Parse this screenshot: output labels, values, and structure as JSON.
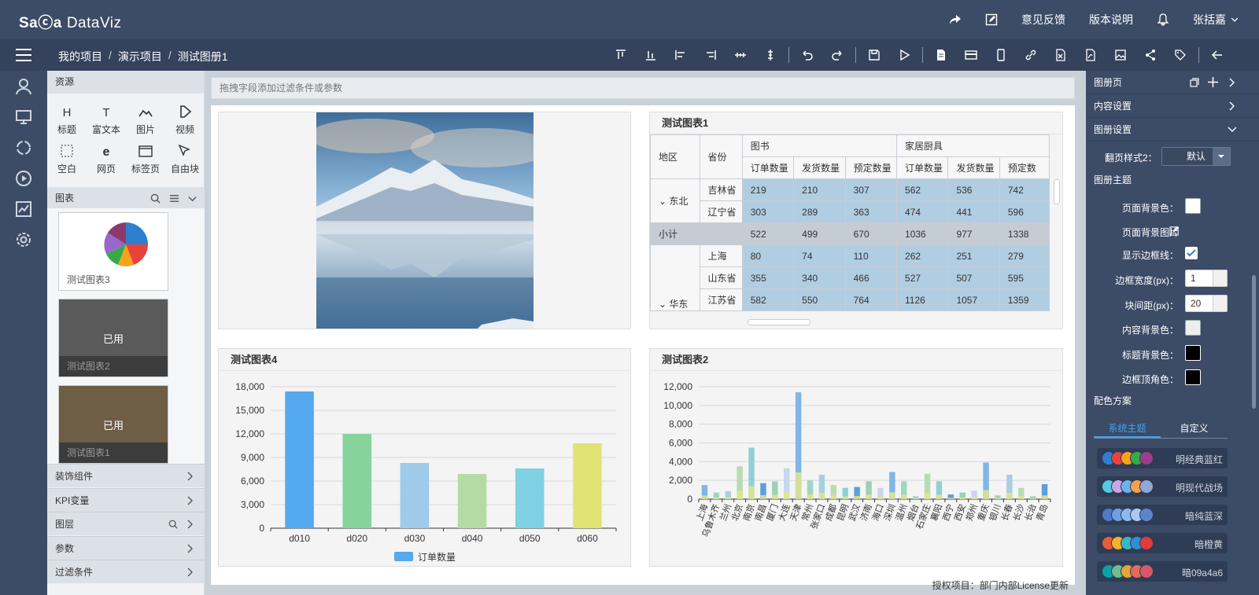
{
  "app": {
    "logo": "Sa",
    "logo_mid": "ⓒa",
    "logo_rest": "DataViz"
  },
  "topbar": {
    "feedback": "意见反馈",
    "version": "版本说明",
    "user": "张括嘉"
  },
  "breadcrumb": [
    "我的项目",
    "演示项目",
    "测试图册1"
  ],
  "toolbar_icons": [
    "align-top-icon",
    "align-bottom-icon",
    "align-left-icon",
    "align-right-icon",
    "distribute-h-icon",
    "distribute-v-icon",
    "undo-icon",
    "redo-icon",
    "save-icon",
    "play-icon",
    "page-icon",
    "card-icon",
    "mobile-icon",
    "link-icon",
    "excel-icon",
    "pdf-icon",
    "image-icon",
    "share-icon",
    "tag-icon",
    "back-icon"
  ],
  "left_panel": {
    "resources_title": "资源",
    "resources": [
      {
        "label": "标题",
        "icon": "heading-icon"
      },
      {
        "label": "富文本",
        "icon": "richtext-icon"
      },
      {
        "label": "图片",
        "icon": "picture-icon"
      },
      {
        "label": "视频",
        "icon": "video-icon"
      },
      {
        "label": "空白",
        "icon": "blank-icon"
      },
      {
        "label": "网页",
        "icon": "webpage-icon"
      },
      {
        "label": "标签页",
        "icon": "tabpage-icon"
      },
      {
        "label": "自由块",
        "icon": "freeblock-icon"
      }
    ],
    "charts_title": "图表",
    "chart_items": [
      {
        "label": "测试图表3",
        "used": ""
      },
      {
        "label": "测试图表2",
        "used": "已用"
      },
      {
        "label": "测试图表1",
        "used": "已用"
      }
    ],
    "sections": [
      "装饰组件",
      "KPI变量",
      "图层",
      "参数",
      "过滤条件"
    ]
  },
  "canvas": {
    "filter_placeholder": "拖拽字段添加过滤条件或参数",
    "license": "授权项目：部门内部License更新"
  },
  "pivot": {
    "title": "测试图表1",
    "region_header": "地区",
    "province_header": "省份",
    "groups": [
      "图书",
      "家居厨具"
    ],
    "measures": [
      "订单数量",
      "发货数量",
      "预定数量",
      "订单数量",
      "发货数量",
      "预定数"
    ],
    "rows": [
      {
        "region": "东北",
        "province": "吉林省",
        "values": [
          "219",
          "210",
          "307",
          "562",
          "536",
          "742"
        ]
      },
      {
        "region": "",
        "province": "辽宁省",
        "values": [
          "303",
          "289",
          "363",
          "474",
          "441",
          "596"
        ]
      },
      {
        "region": "小计",
        "province": "",
        "values": [
          "522",
          "499",
          "670",
          "1036",
          "977",
          "1338"
        ]
      },
      {
        "region": "华东",
        "province": "上海",
        "values": [
          "80",
          "74",
          "110",
          "262",
          "251",
          "279"
        ]
      },
      {
        "region": "",
        "province": "山东省",
        "values": [
          "355",
          "340",
          "466",
          "527",
          "507",
          "595"
        ]
      },
      {
        "region": "",
        "province": "江苏省",
        "values": [
          "582",
          "550",
          "764",
          "1126",
          "1057",
          "1359"
        ]
      }
    ]
  },
  "chart_data": [
    {
      "type": "bar",
      "title": "测试图表4",
      "categories": [
        "d010",
        "d020",
        "d030",
        "d040",
        "d050",
        "d060"
      ],
      "series": [
        {
          "name": "订单数量",
          "values": [
            17400,
            12000,
            8300,
            6900,
            7600,
            10800
          ]
        }
      ],
      "yticks": [
        "0",
        "3,000",
        "6,000",
        "9,000",
        "12,000",
        "15,000",
        "18,000"
      ],
      "ylim": [
        0,
        18000
      ],
      "colors": [
        "#55a9ee",
        "#86d49c",
        "#9ecbea",
        "#b5dba5",
        "#7fd1e3",
        "#e1e375"
      ],
      "legend_color": "#55a9ee"
    },
    {
      "type": "bar",
      "title": "测试图表2",
      "categories": [
        "上海",
        "乌鲁木齐",
        "兰州",
        "北京",
        "南京",
        "南昌",
        "厦门",
        "大连",
        "天津",
        "常州",
        "张家口",
        "成都",
        "昆明",
        "武汉",
        "济南",
        "海口",
        "深圳",
        "温州",
        "烟台",
        "石家庄",
        "襄阳",
        "西宁",
        "西安",
        "郑州",
        "重庆",
        "银川",
        "长春",
        "长沙",
        "长治",
        "青岛"
      ],
      "values": [
        1500,
        700,
        850,
        3500,
        5500,
        1700,
        1900,
        3300,
        11400,
        2000,
        2600,
        1500,
        1200,
        1300,
        1900,
        1200,
        2900,
        1900,
        300,
        2700,
        1900,
        500,
        700,
        900,
        3900,
        400,
        2600,
        1200,
        300,
        1600
      ],
      "yticks": [
        "0",
        "2,000",
        "4,000",
        "6,000",
        "8,000",
        "10,000",
        "12,000"
      ],
      "ylim": [
        0,
        12000
      ],
      "colors": [
        "#7fb7e6",
        "#9fd6c1",
        "#a7cfe0",
        "#b8dcb0",
        "#8fd0d6",
        "#5e9fd8",
        "#9bd1b7",
        "#c6d8f0"
      ]
    }
  ],
  "right_panel": {
    "atlas_page": "图册页",
    "content_settings": "内容设置",
    "atlas_settings": "图册设置",
    "flip_style_label": "翻页样式2：",
    "flip_style_value": "默认",
    "theme_title": "图册主题",
    "page_bg_color": "页面背景色：",
    "page_bg_image": "页面背景图片",
    "show_border": "显示边框线：",
    "border_width": "边框宽度(px)：",
    "border_width_value": "1",
    "block_spacing": "块间距(px)：",
    "block_spacing_value": "20",
    "content_bg": "内容背景色：",
    "title_bg": "标题背景色：",
    "border_corner": "边框顶角色：",
    "scheme_title": "配色方案",
    "tab_system": "系统主题",
    "tab_custom": "自定义",
    "palettes": [
      {
        "name": "明经典蓝红",
        "colors": [
          "#2f7fd0",
          "#e8433b",
          "#f6a21a",
          "#38a947",
          "#9a3d8c"
        ]
      },
      {
        "name": "明现代战场",
        "colors": [
          "#57c7e3",
          "#c9a5e6",
          "#6fb0f0",
          "#f7a04a",
          "#8fa8d8"
        ]
      },
      {
        "name": "暗纯蓝深",
        "colors": [
          "#4f79c9",
          "#6ea0e0",
          "#8fb8f0",
          "#aac8f0",
          "#5c86cc"
        ]
      },
      {
        "name": "暗橙黄",
        "colors": [
          "#e85c3a",
          "#f7b22a",
          "#39b7c9",
          "#2f8fd6",
          "#e13c3c"
        ]
      },
      {
        "name": "暗09a4a6",
        "colors": [
          "#09a4a6",
          "#6fbf8e",
          "#e8a33a",
          "#e36b5c",
          "#d35a6a"
        ]
      }
    ]
  }
}
